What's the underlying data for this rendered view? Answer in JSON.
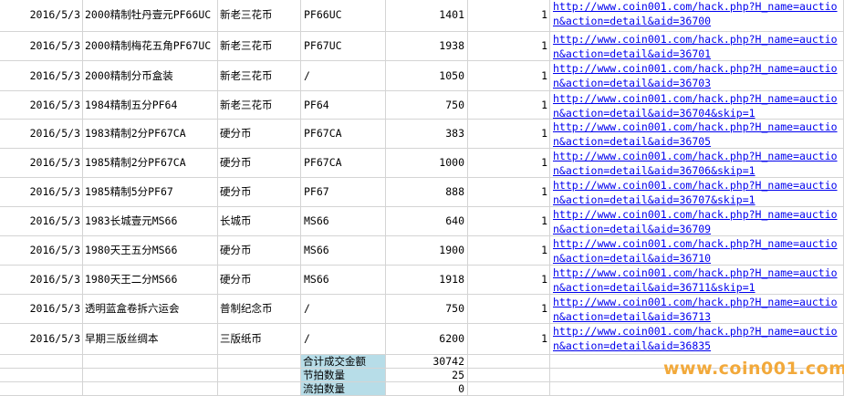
{
  "rows": [
    {
      "date": "2016/5/3",
      "name": "2000精制牡丹壹元PF66UC",
      "category": "新老三花币",
      "grade": "PF66UC",
      "price": "1401",
      "qty": "1",
      "link": "http://www.coin001.com/hack.php?H_name=auction&action=detail&aid=36700"
    },
    {
      "date": "2016/5/3",
      "name": "2000精制梅花五角PF67UC",
      "category": "新老三花币",
      "grade": "PF67UC",
      "price": "1938",
      "qty": "1",
      "link": "http://www.coin001.com/hack.php?H_name=auction&action=detail&aid=36701"
    },
    {
      "date": "2016/5/3",
      "name": "2000精制分币盒装",
      "category": "新老三花币",
      "grade": "/",
      "price": "1050",
      "qty": "1",
      "link": "http://www.coin001.com/hack.php?H_name=auction&action=detail&aid=36703"
    },
    {
      "date": "2016/5/3",
      "name": "1984精制五分PF64",
      "category": "新老三花币",
      "grade": "PF64",
      "price": "750",
      "qty": "1",
      "link": "http://www.coin001.com/hack.php?H_name=auction&action=detail&aid=36704&skip=1"
    },
    {
      "date": "2016/5/3",
      "name": "1983精制2分PF67CA",
      "category": "硬分币",
      "grade": "PF67CA",
      "price": "383",
      "qty": "1",
      "link": "http://www.coin001.com/hack.php?H_name=auction&action=detail&aid=36705"
    },
    {
      "date": "2016/5/3",
      "name": "1985精制2分PF67CA",
      "category": "硬分币",
      "grade": "PF67CA",
      "price": "1000",
      "qty": "1",
      "link": "http://www.coin001.com/hack.php?H_name=auction&action=detail&aid=36706&skip=1"
    },
    {
      "date": "2016/5/3",
      "name": "1985精制5分PF67",
      "category": "硬分币",
      "grade": "PF67",
      "price": "888",
      "qty": "1",
      "link": "http://www.coin001.com/hack.php?H_name=auction&action=detail&aid=36707&skip=1"
    },
    {
      "date": "2016/5/3",
      "name": "1983长城壹元MS66",
      "category": "长城币",
      "grade": "MS66",
      "price": "640",
      "qty": "1",
      "link": "http://www.coin001.com/hack.php?H_name=auction&action=detail&aid=36709"
    },
    {
      "date": "2016/5/3",
      "name": "1980天王五分MS66",
      "category": "硬分币",
      "grade": "MS66",
      "price": "1900",
      "qty": "1",
      "link": "http://www.coin001.com/hack.php?H_name=auction&action=detail&aid=36710"
    },
    {
      "date": "2016/5/3",
      "name": "1980天王二分MS66",
      "category": "硬分币",
      "grade": "MS66",
      "price": "1918",
      "qty": "1",
      "link": "http://www.coin001.com/hack.php?H_name=auction&action=detail&aid=36711&skip=1"
    },
    {
      "date": "2016/5/3",
      "name": "透明蓝盒卷拆六运会",
      "category": "普制纪念币",
      "grade": "/",
      "price": "750",
      "qty": "1",
      "link": "http://www.coin001.com/hack.php?H_name=auction&action=detail&aid=36713"
    },
    {
      "date": "2016/5/3",
      "name": "早期三版丝绸本",
      "category": "三版纸币",
      "grade": "/",
      "price": "6200",
      "qty": "1",
      "link": "http://www.coin001.com/hack.php?H_name=auction&action=detail&aid=36835"
    }
  ],
  "summary": [
    {
      "label": "合计成交金额",
      "value": "30742"
    },
    {
      "label": "节拍数量",
      "value": "25"
    },
    {
      "label": "流拍数量",
      "value": "0"
    }
  ],
  "watermark": "www.coin001.com",
  "colors": {
    "label_bg": "#b7dde8",
    "link": "#0000ee",
    "watermark": "#f2a93b",
    "grid": "#d4d4d4"
  }
}
